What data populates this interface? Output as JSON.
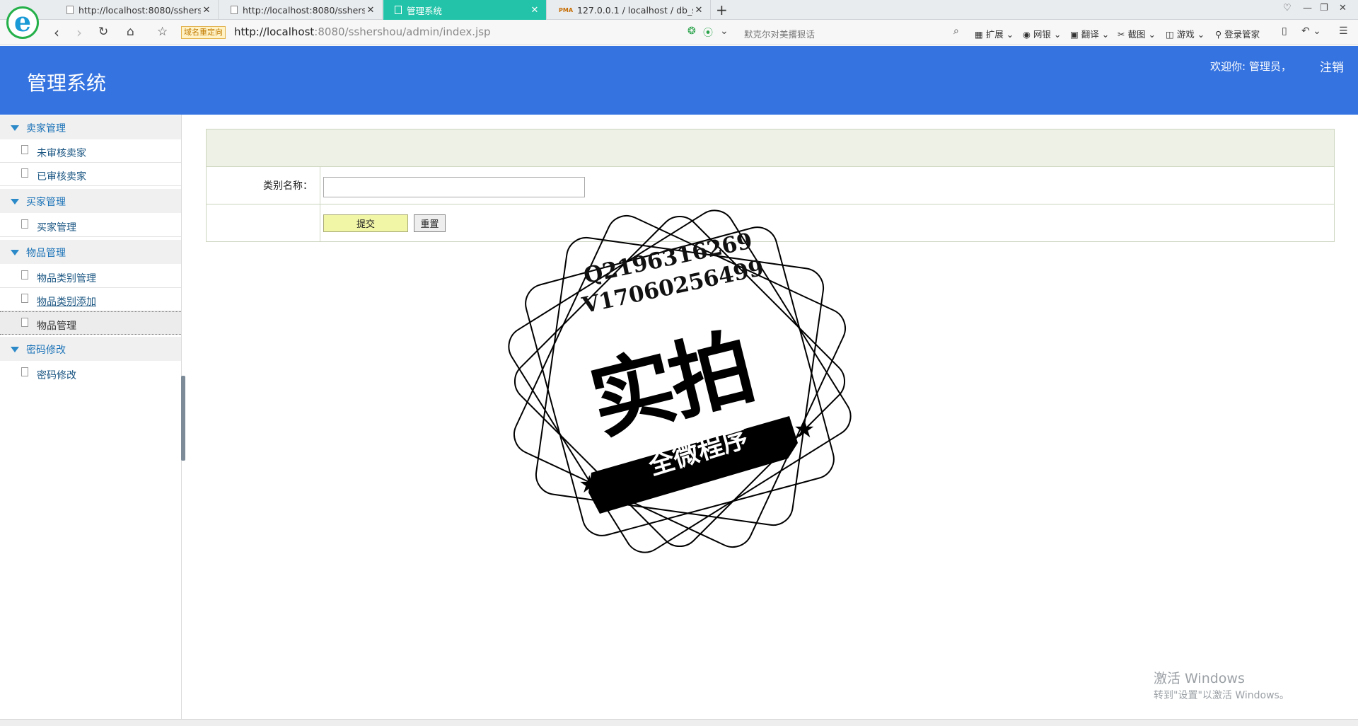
{
  "browser": {
    "tabs": [
      {
        "title": "http://localhost:8080/sshershou"
      },
      {
        "title": "http://localhost:8080/sshershou"
      },
      {
        "title": "管理系统"
      },
      {
        "title": "127.0.0.1 / localhost / db_sshe"
      }
    ],
    "pma_badge": "PMA",
    "redirect_badge": "域名重定向",
    "url_host": "http://localhost",
    "url_rest": ":8080/sshershou/admin/index.jsp",
    "search_hint": "默克尔对美撂狠话",
    "toolbar": {
      "extensions": "扩展",
      "netbank": "网银",
      "translate": "翻译",
      "screenshot": "截图",
      "games": "游戏",
      "login_manager": "登录管家"
    }
  },
  "app": {
    "title": "管理系统",
    "welcome": "欢迎你: 管理员，",
    "logout": "注销"
  },
  "sidebar": {
    "groups": [
      {
        "label": "卖家管理",
        "items": [
          {
            "label": "未审核卖家"
          },
          {
            "label": "已审核卖家"
          }
        ]
      },
      {
        "label": "买家管理",
        "items": [
          {
            "label": "买家管理"
          }
        ]
      },
      {
        "label": "物品管理",
        "items": [
          {
            "label": "物品类别管理"
          },
          {
            "label": "物品类别添加"
          },
          {
            "label": "物品管理"
          }
        ]
      },
      {
        "label": "密码修改",
        "items": [
          {
            "label": "密码修改"
          }
        ]
      }
    ]
  },
  "form": {
    "category_label": "类别名称：",
    "category_value": "",
    "submit": "提交",
    "reset": "重置"
  },
  "watermark": {
    "line1": "Q2196316269",
    "line2": "V17060256499",
    "main": "实拍",
    "sub": "全微程序"
  },
  "windows": {
    "activate_title": "激活 Windows",
    "activate_hint": "转到\"设置\"以激活 Windows。"
  }
}
